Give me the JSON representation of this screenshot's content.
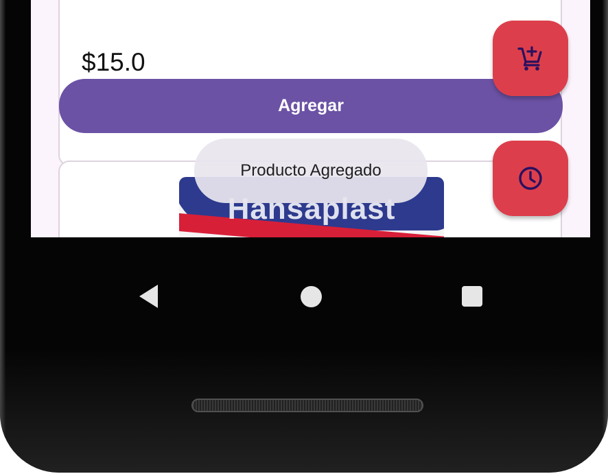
{
  "product": {
    "price": "$15.0",
    "add_button_label": "Agregar",
    "image_brand_text": "Hansaplast"
  },
  "toast": {
    "message": "Producto Agregado"
  },
  "fabs": [
    {
      "icon": "add-shopping-cart-icon"
    },
    {
      "icon": "clock-icon"
    }
  ],
  "navigation": {
    "back_icon": "back-triangle-icon",
    "home_icon": "home-circle-icon",
    "recents_icon": "recents-square-icon"
  },
  "colors": {
    "screen_background": "#fcf4fc",
    "primary_button": "#6b52a5",
    "fab": "#dc3f4b",
    "fab_icon": "#2a1060",
    "toast_background": "#e8e5ee"
  }
}
